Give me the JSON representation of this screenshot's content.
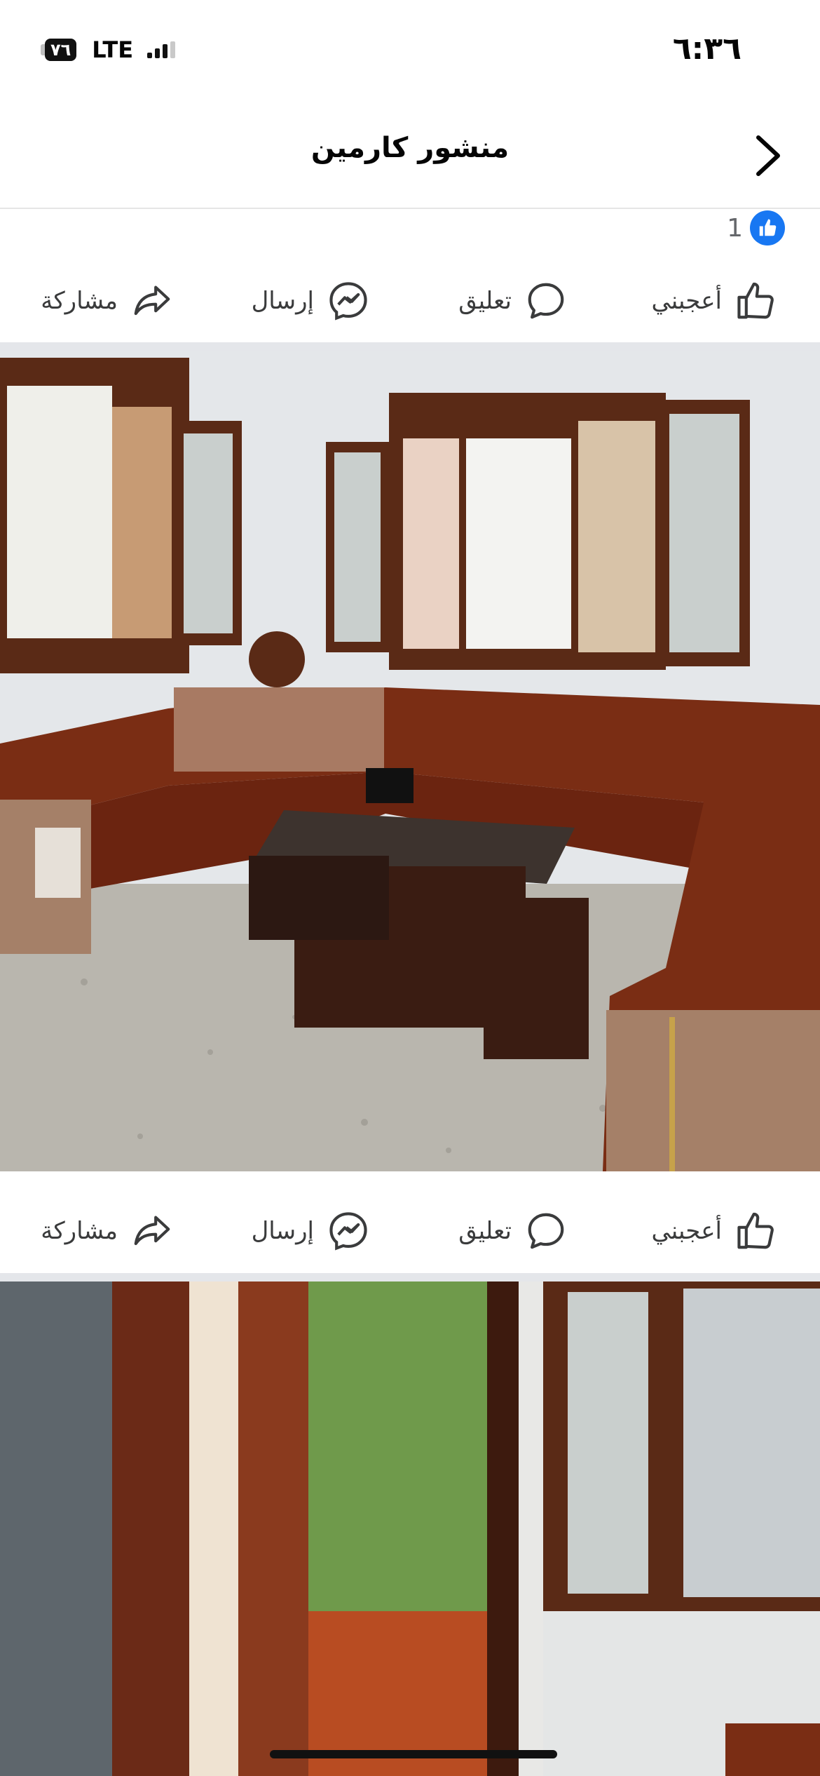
{
  "status_bar": {
    "time": "٦:٣٦",
    "battery": "٧٦",
    "network": "LTE"
  },
  "header": {
    "title": "منشور كارمين"
  },
  "reactions": {
    "count": "1",
    "icon": "like-icon"
  },
  "actions": {
    "like_label": "أعجبني",
    "comment_label": "تعليق",
    "send_label": "إرسال",
    "share_label": "مشاركة"
  },
  "colors": {
    "like_blue": "#1877f2",
    "sofa": "#7a2d14",
    "wall": "#e3e6e8"
  }
}
